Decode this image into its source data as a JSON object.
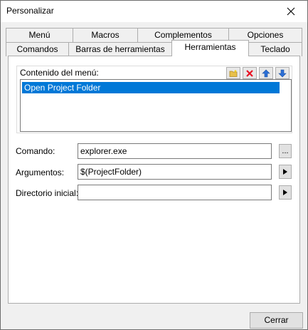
{
  "window": {
    "title": "Personalizar"
  },
  "tabs": {
    "row1": [
      "Menú",
      "Macros",
      "Complementos",
      "Opciones"
    ],
    "row2": [
      "Comandos",
      "Barras de herramientas",
      "Herramientas",
      "Teclado"
    ],
    "active": "Herramientas"
  },
  "menu_contents": {
    "label": "Contenido del menú:",
    "items": [
      "Open Project Folder"
    ],
    "selected_index": 0,
    "toolbar_icons": [
      "new-folder-icon",
      "delete-icon",
      "move-up-icon",
      "move-down-icon"
    ]
  },
  "fields": {
    "command_label": "Comando:",
    "command_value": "explorer.exe",
    "browse_label": "...",
    "arguments_label": "Argumentos:",
    "arguments_value": "$(ProjectFolder)",
    "initial_dir_label": "Directorio inicial:",
    "initial_dir_value": ""
  },
  "footer": {
    "close_label": "Cerrar"
  },
  "colors": {
    "selection": "#0078d7",
    "delete_red": "#e81123",
    "arrow_blue": "#2b6fd6"
  }
}
